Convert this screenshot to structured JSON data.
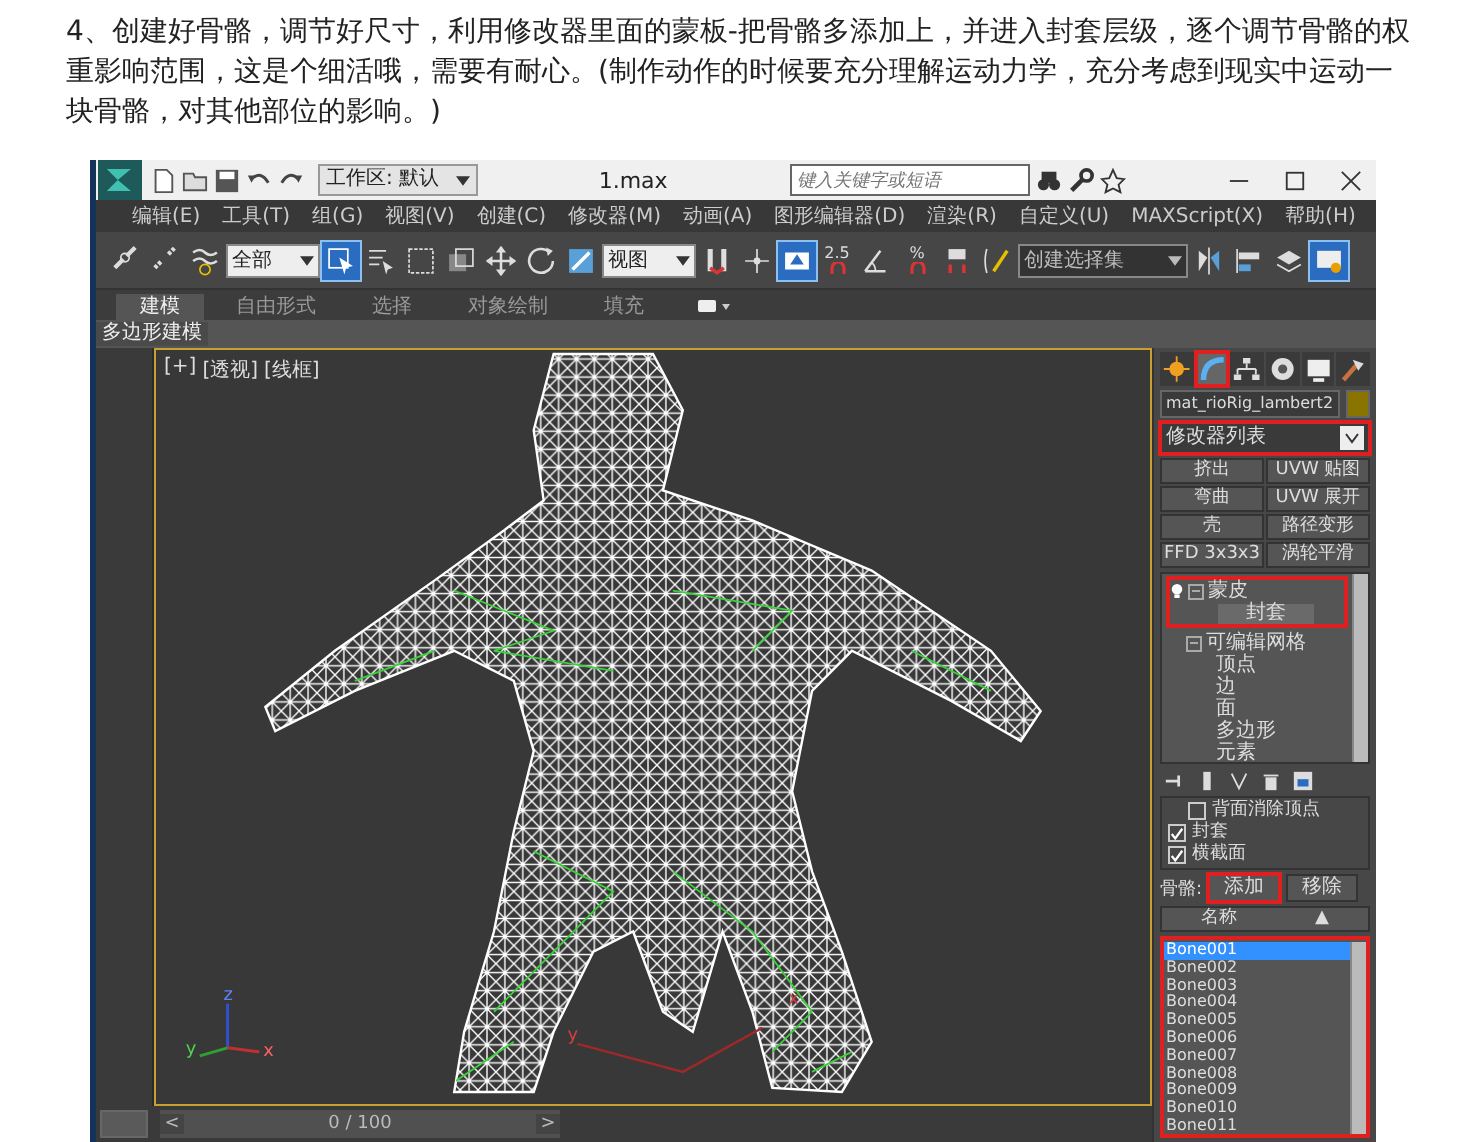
{
  "article": {
    "text": "4、创建好骨骼，调节好尺寸，利用修改器里面的蒙板-把骨骼多添加上，并进入封套层级，逐个调节骨骼的权重影响范围，这是个细活哦，需要有耐心。(制作动作的时候要充分理解运动力学，充分考虑到现实中运动一块骨骼，对其他部位的影响。)"
  },
  "app": {
    "title_bar": {
      "workspace": "工作区: 默认",
      "file_title": "1.max",
      "search": {
        "placeholder": "键入关键字或短语"
      }
    },
    "menu": [
      "编辑(E)",
      "工具(T)",
      "组(G)",
      "视图(V)",
      "创建(C)",
      "修改器(M)",
      "动画(A)",
      "图形编辑器(D)",
      "渲染(R)",
      "自定义(U)",
      "MAXScript(X)",
      "帮助(H)"
    ],
    "toolbar": [
      {
        "kind": "link",
        "active": false
      },
      {
        "kind": "unlink",
        "active": false
      },
      {
        "kind": "bind",
        "active": false
      },
      {
        "kind": "dropdown",
        "label": "全部"
      },
      {
        "kind": "select",
        "active": true
      },
      {
        "kind": "select-name",
        "active": false
      },
      {
        "kind": "rect",
        "active": false
      },
      {
        "kind": "window",
        "active": false
      },
      {
        "kind": "move",
        "active": false
      },
      {
        "kind": "rotate",
        "active": false
      },
      {
        "kind": "scale",
        "active": false
      },
      {
        "kind": "dropdown",
        "label": "视图"
      },
      {
        "kind": "pivot",
        "active": false
      },
      {
        "kind": "manipulate",
        "active": false
      },
      {
        "kind": "keyboard",
        "active": true
      },
      {
        "kind": "snap",
        "label": "2.5",
        "active": false
      },
      {
        "kind": "angle",
        "active": false
      },
      {
        "kind": "snap",
        "label": "%",
        "active": false
      },
      {
        "kind": "spinner",
        "active": false
      },
      {
        "kind": "named",
        "active": false
      },
      {
        "kind": "dropdown",
        "label": "创建选择集"
      },
      {
        "kind": "mirror",
        "active": false
      },
      {
        "kind": "align",
        "active": false
      },
      {
        "kind": "layers",
        "active": false
      },
      {
        "kind": "render",
        "active": true
      }
    ],
    "ribbon": {
      "tabs": [
        {
          "label": "建模",
          "selected": true
        },
        {
          "label": "自由形式",
          "selected": false
        },
        {
          "label": "选择",
          "selected": false
        },
        {
          "label": "对象绘制",
          "selected": false
        },
        {
          "label": "填充",
          "selected": false
        }
      ],
      "panel_label": "多边形建模"
    },
    "viewport": {
      "labels": [
        "[+]",
        "[透视]",
        "[线框]"
      ],
      "gizmo_labels": [
        "z",
        "y",
        "x"
      ],
      "grid_labels": [
        "y",
        "x"
      ]
    },
    "timeline": {
      "prev": "<",
      "position": "0 / 100",
      "next": ">"
    },
    "command_panel": {
      "tabs": [
        {
          "kind": "create",
          "selected": false,
          "highlighted": false
        },
        {
          "kind": "modify",
          "selected": true,
          "highlighted": true
        },
        {
          "kind": "hierarchy",
          "selected": false,
          "highlighted": false
        },
        {
          "kind": "motion",
          "selected": false,
          "highlighted": false
        },
        {
          "kind": "display",
          "selected": false,
          "highlighted": false
        },
        {
          "kind": "utilities",
          "selected": false,
          "highlighted": false
        }
      ],
      "object_name": "mat_rioRig_lambert2",
      "modifier_list": {
        "label": "修改器列表",
        "highlighted": true
      },
      "modifier_buttons": [
        "挤出",
        "UVW 贴图",
        "弯曲",
        "UVW 展开",
        "壳",
        "路径变形",
        "FFD 3x3x3",
        "涡轮平滑"
      ],
      "stack": [
        {
          "label": "蒙皮",
          "expanded": true,
          "highlighted": true,
          "children": [
            {
              "label": "封套",
              "selected": true
            }
          ]
        },
        {
          "label": "可编辑网格",
          "expanded": true,
          "highlighted": false,
          "children": [
            {
              "label": "顶点",
              "selected": false
            },
            {
              "label": "边",
              "selected": false
            },
            {
              "label": "面",
              "selected": false
            },
            {
              "label": "多边形",
              "selected": false
            },
            {
              "label": "元素",
              "selected": false
            }
          ]
        }
      ],
      "params": {
        "checkboxes": [
          {
            "label": "背面消除顶点",
            "checked": false
          },
          {
            "label": "封套",
            "checked": true
          },
          {
            "label": "横截面",
            "checked": true
          }
        ],
        "bones_label": "骨骼:",
        "add_button": {
          "label": "添加",
          "highlighted": true
        },
        "remove_button": "移除",
        "list_header": "名称",
        "sort_indicator": "▲",
        "bones_highlighted": true,
        "bones": [
          {
            "name": "Bone001",
            "selected": true
          },
          {
            "name": "Bone002",
            "selected": false
          },
          {
            "name": "Bone003",
            "selected": false
          },
          {
            "name": "Bone004",
            "selected": false
          },
          {
            "name": "Bone005",
            "selected": false
          },
          {
            "name": "Bone006",
            "selected": false
          },
          {
            "name": "Bone007",
            "selected": false
          },
          {
            "name": "Bone008",
            "selected": false
          },
          {
            "name": "Bone009",
            "selected": false
          },
          {
            "name": "Bone010",
            "selected": false
          },
          {
            "name": "Bone011",
            "selected": false
          }
        ]
      }
    }
  }
}
